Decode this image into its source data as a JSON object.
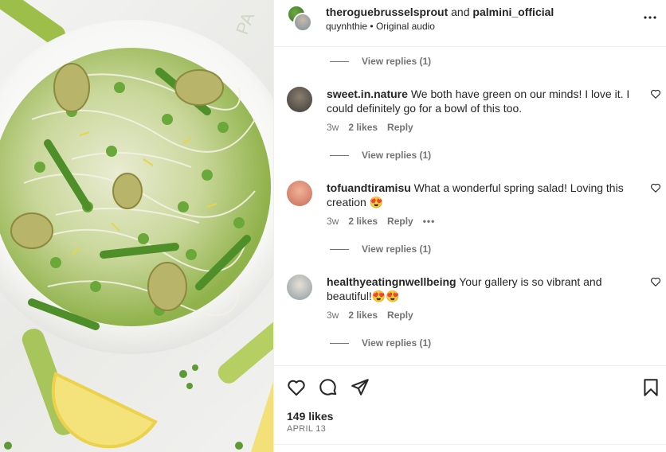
{
  "header": {
    "account1": "theroguebrusselsprout",
    "joiner": "and",
    "account2": "palmini_official",
    "sub_user": "quynhthie",
    "separator": "•",
    "audio": "Original audio"
  },
  "replies_link": "View replies (1)",
  "comments": [
    {
      "username": "sweet.in.nature",
      "text": "We both have green on our minds! I love it. I could definitely go for a bowl of this too.",
      "age": "3w",
      "likes": "2 likes",
      "reply": "Reply"
    },
    {
      "username": "tofuandtiramisu",
      "text": "What a wonderful spring salad! Loving this creation 😍",
      "age": "3w",
      "likes": "2 likes",
      "reply": "Reply",
      "more": "•••"
    },
    {
      "username": "healthyeatingnwellbeing",
      "text": "Your gallery is so vibrant and beautiful!😍😍",
      "age": "3w",
      "likes": "2 likes",
      "reply": "Reply"
    }
  ],
  "footer": {
    "likes": "149 likes",
    "date": "APRIL 13"
  },
  "icons": {
    "more": "more-horizontal-icon",
    "like": "heart-icon",
    "comment": "comment-icon",
    "share": "send-icon",
    "save": "bookmark-icon"
  },
  "colors": {
    "text": "#262626",
    "muted": "#737373",
    "divider": "#efefef"
  }
}
